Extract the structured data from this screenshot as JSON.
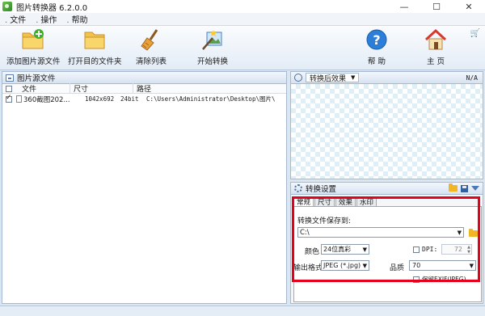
{
  "window": {
    "title": "图片转换器 6.2.0.0",
    "controls": {
      "minimize": "—",
      "maximize": "☐",
      "close": "✕"
    }
  },
  "menu": {
    "items": [
      {
        "label": "文件"
      },
      {
        "label": "操作"
      },
      {
        "label": "帮助"
      }
    ]
  },
  "toolbar": {
    "add_source": "添加图片源文件",
    "open_target": "打开目的文件夹",
    "clear_list": "清除列表",
    "start_convert": "开始转换",
    "help": "帮 助",
    "home": "主 页",
    "icons": [
      "add-folder-icon",
      "open-folder-icon",
      "broom-icon",
      "convert-wand-icon",
      "help-icon",
      "home-icon",
      "cart-icon"
    ]
  },
  "source_panel": {
    "title": "图片源文件",
    "columns": {
      "name": "文件",
      "size": "尺寸",
      "path": "路径"
    },
    "rows": [
      {
        "checked": true,
        "name": "360截图202...",
        "dimensions": "1042x692",
        "bit_depth": "24bit",
        "path": "C:\\Users\\Administrator\\Desktop\\图片\\"
      }
    ]
  },
  "preview_panel": {
    "effect_label": "转换后效果",
    "na": "N/A"
  },
  "settings_panel": {
    "title": "转换设置",
    "tabs": [
      "常规",
      "尺寸",
      "效果",
      "水印"
    ],
    "active_tab": "常规",
    "save_to_label": "转换文件保存到:",
    "save_path": "C:\\",
    "color_label": "颜色",
    "color_value": "24位真彩",
    "dpi_label": "DPI:",
    "dpi_checked": false,
    "dpi_value": "72",
    "format_label": "输出格式:",
    "format_value": "JPEG (*.jpg)",
    "quality_label": "品质",
    "quality_value": "70",
    "exif_label": "保留EXIF(JPEG)",
    "exif_checked": false
  },
  "colors": {
    "highlight": "#e5001c",
    "panel_border": "#a7b9cf",
    "header_bg": "#d7e3f1",
    "app_bg": "#dbe6f3"
  }
}
